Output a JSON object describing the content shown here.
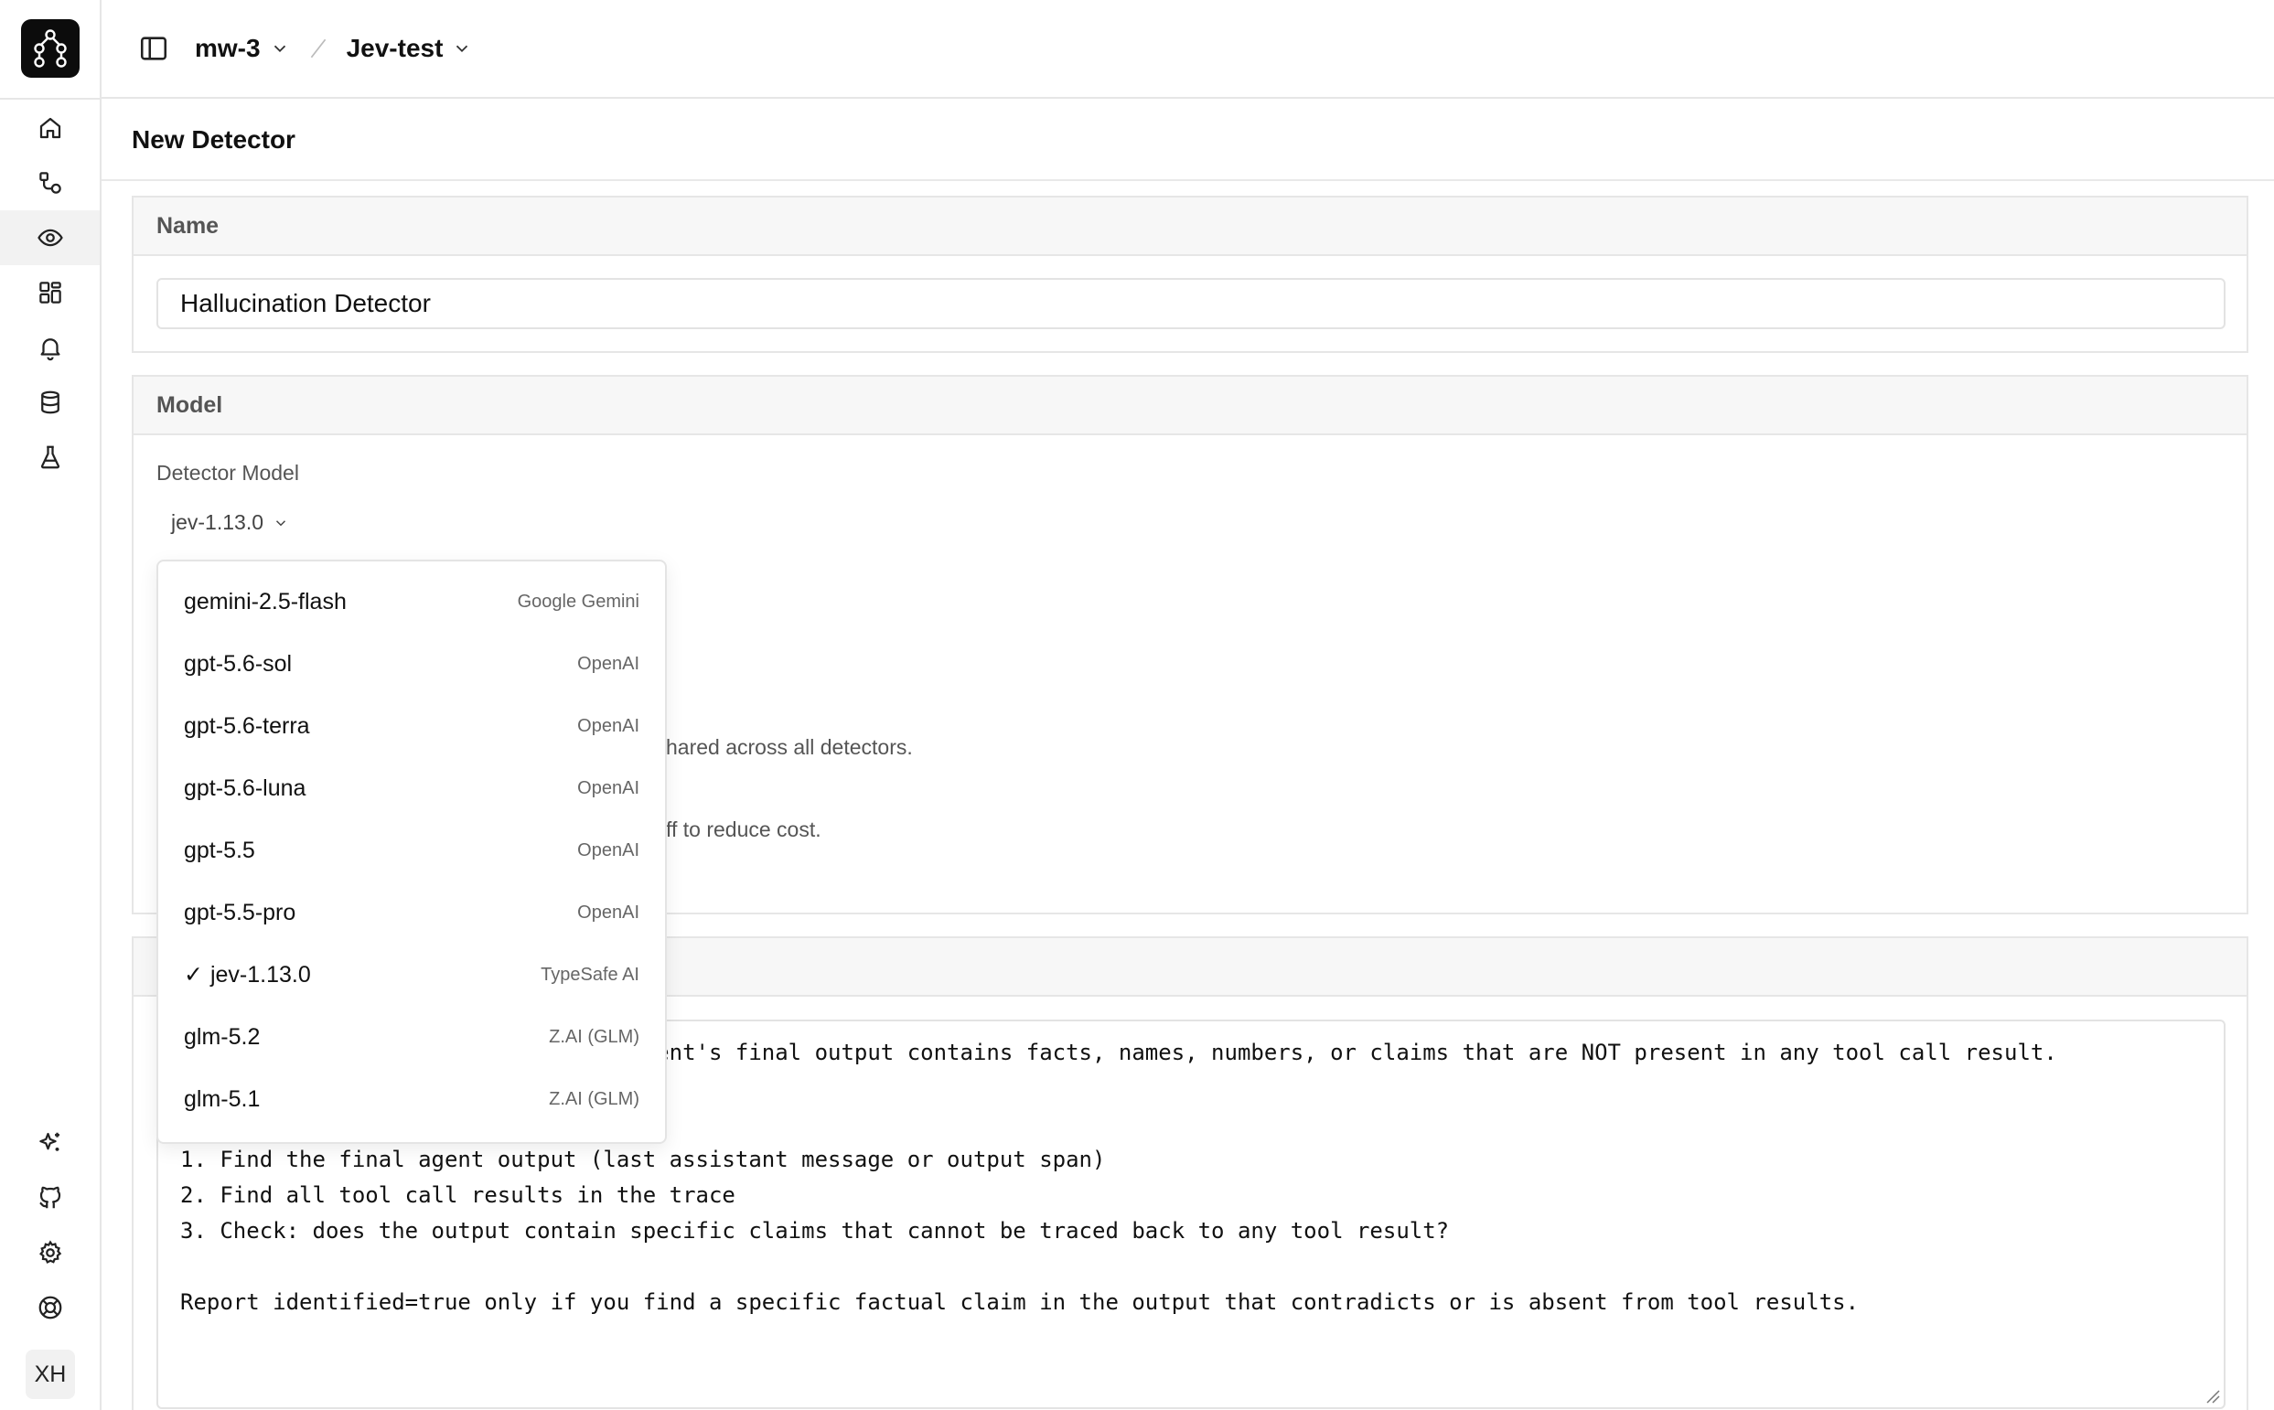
{
  "header": {
    "workspace": "mw-3",
    "project": "Jev-test"
  },
  "page": {
    "title": "New Detector"
  },
  "name_section": {
    "heading": "Name",
    "value": "Hallucination Detector"
  },
  "model_section": {
    "heading": "Model",
    "field_label": "Detector Model",
    "selected_model": "jev-1.13.0"
  },
  "hidden_hints": {
    "hint1": "hared across all detectors.",
    "hint2": "ff to reduce cost."
  },
  "dropdown": {
    "options": [
      {
        "name": "gemini-2.5-flash",
        "provider": "Google Gemini",
        "selected": false
      },
      {
        "name": "gpt-5.6-sol",
        "provider": "OpenAI",
        "selected": false
      },
      {
        "name": "gpt-5.6-terra",
        "provider": "OpenAI",
        "selected": false
      },
      {
        "name": "gpt-5.6-luna",
        "provider": "OpenAI",
        "selected": false
      },
      {
        "name": "gpt-5.5",
        "provider": "OpenAI",
        "selected": false
      },
      {
        "name": "gpt-5.5-pro",
        "provider": "OpenAI",
        "selected": false
      },
      {
        "name": "jev-1.13.0",
        "provider": "TypeSafe AI",
        "selected": true
      },
      {
        "name": "glm-5.2",
        "provider": "Z.AI (GLM)",
        "selected": false
      },
      {
        "name": "glm-5.1",
        "provider": "Z.AI (GLM)",
        "selected": false
      }
    ],
    "check_mark": "✓"
  },
  "prompt": {
    "line1": "                              the agent's final output contains facts, names, numbers, or claims that are NOT present in any tool call result.",
    "line2": "",
    "line3": "",
    "line4": "1. Find the final agent output (last assistant message or output span)",
    "line5": "2. Find all tool call results in the trace",
    "line6": "3. Check: does the output contain specific claims that cannot be traced back to any tool result?",
    "line7": "",
    "line8": "Report identified=true only if you find a specific factual claim in the output that contradicts or is absent from tool results."
  },
  "user": {
    "initials": "XH"
  }
}
